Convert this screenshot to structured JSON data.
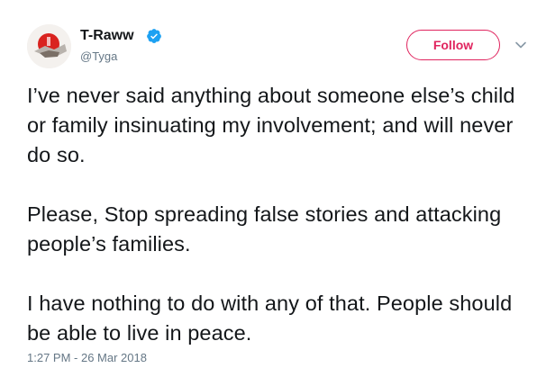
{
  "user": {
    "display_name": "T-Raww",
    "handle": "@Tyga",
    "verified": true
  },
  "header": {
    "follow_label": "Follow",
    "menu_icon": "chevron-down-icon"
  },
  "tweet": {
    "paragraphs": [
      "I’ve never said anything about someone else’s child or family insinuating my involvement; and will never do so.",
      "Please, Stop spreading false stories and attacking people’s families.",
      "I have nothing to do with any of that. People should be able to live in peace."
    ],
    "timestamp": "1:27 PM - 26 Mar 2018"
  },
  "colors": {
    "accent": "#e0245e",
    "verified": "#1da1f2",
    "text": "#14171a",
    "muted": "#657786"
  }
}
